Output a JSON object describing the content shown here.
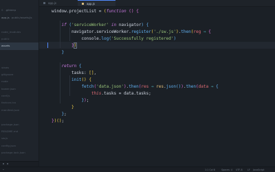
{
  "sidebar": {
    "items": [
      {
        "label": "",
        "sub": ""
      },
      {
        "label": "S",
        "sub": ".gitkeep"
      },
      {
        "label": "app.js",
        "sub": "public/assets/js"
      },
      {
        "label": "",
        "sub": ""
      },
      {
        "label": "node_modules",
        "sub": ""
      },
      {
        "label": "public",
        "sub": ""
      },
      {
        "label": "assets",
        "sub": ""
      },
      {
        "label": "",
        "sub": ""
      },
      {
        "label": "",
        "sub": ""
      },
      {
        "label": "views",
        "sub": ""
      },
      {
        "label": "gitignore",
        "sub": ""
      },
      {
        "label": "node",
        "sub": ""
      },
      {
        "label": "bower.json",
        "sub": ""
      },
      {
        "label": "conf.js",
        "sub": ""
      },
      {
        "label": "favicon.ico",
        "sub": ""
      },
      {
        "label": "manifest.json",
        "sub": ""
      },
      {
        "label": "",
        "sub": ""
      },
      {
        "label": "package.json",
        "sub": ""
      },
      {
        "label": "README.md",
        "sub": ""
      },
      {
        "label": "sw.js",
        "sub": ""
      },
      {
        "label": "config.json",
        "sub": ""
      },
      {
        "label": "package.lock.json",
        "sub": ""
      },
      {
        "label": "",
        "sub": ""
      }
    ]
  },
  "tabs": [
    {
      "label": "app.js"
    },
    {
      "label": "app.js"
    }
  ],
  "status": {
    "cursor_pos": "1:1  Col 6",
    "spaces": "Spaces: 4",
    "encoding": "UTF-8",
    "eol": "LF",
    "language": "JavaScript",
    "dot": "•"
  }
}
